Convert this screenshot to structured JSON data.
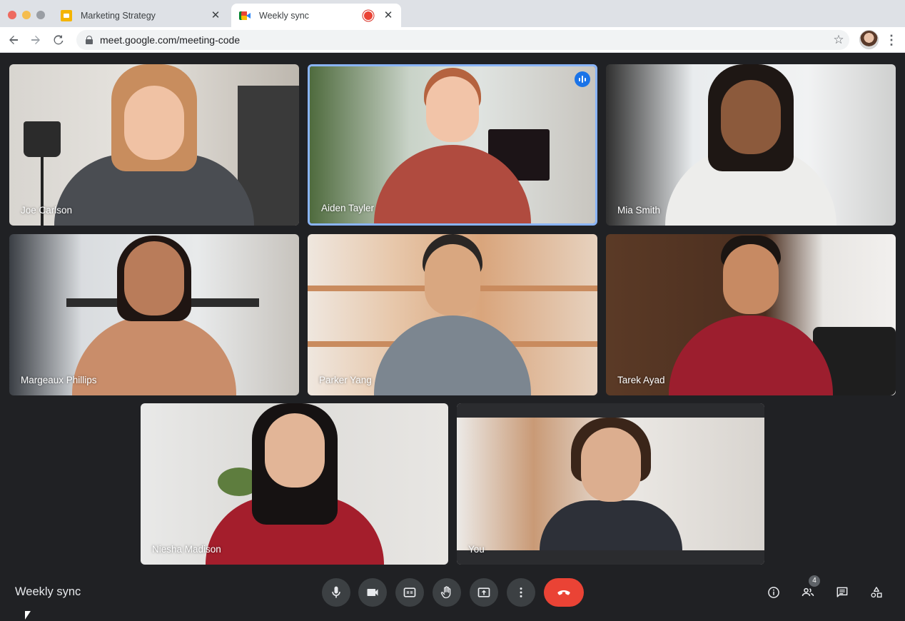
{
  "browser": {
    "tabs": [
      {
        "title": "Marketing Strategy",
        "favicon": "slides-icon"
      },
      {
        "title": "Weekly sync",
        "favicon": "meet-icon",
        "recording": true
      }
    ],
    "url": "meet.google.com/meeting-code"
  },
  "meeting": {
    "title": "Weekly sync",
    "people_count": "4",
    "participants": [
      {
        "name": "Joe Carlson",
        "speaking": false
      },
      {
        "name": "Aiden Tayler",
        "speaking": true
      },
      {
        "name": "Mia Smith",
        "speaking": false
      },
      {
        "name": "Margeaux Phillips",
        "speaking": false
      },
      {
        "name": "Parker Yang",
        "speaking": false
      },
      {
        "name": "Tarek Ayad",
        "speaking": false
      },
      {
        "name": "Niesha Madison",
        "speaking": false
      },
      {
        "name": "You",
        "speaking": false
      }
    ]
  },
  "controls": {
    "bottom": [
      "mic-icon",
      "camera-icon",
      "captions-icon",
      "raise-hand-icon",
      "present-screen-icon",
      "more-options-icon",
      "end-call-icon"
    ],
    "side": [
      "info-icon",
      "people-icon",
      "chat-icon",
      "activities-icon"
    ]
  },
  "colors": {
    "background": "#202124",
    "speaking_border": "#8ab4f8",
    "end_call": "#ea4335",
    "control_bg": "#3c4043"
  }
}
